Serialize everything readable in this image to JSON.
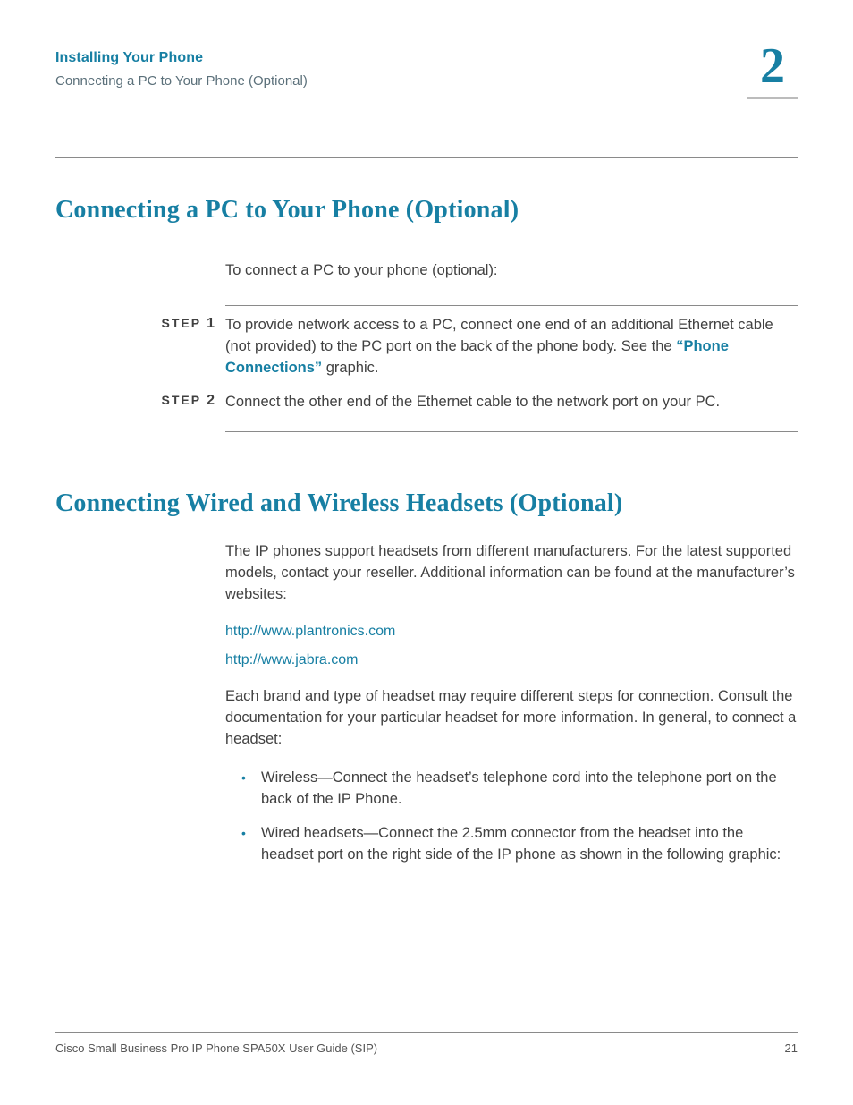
{
  "header": {
    "title": "Installing Your Phone",
    "subtitle": "Connecting a PC to Your Phone (Optional)",
    "chapter_number": "2"
  },
  "section1": {
    "heading": "Connecting a PC to Your Phone (Optional)",
    "intro": "To connect a PC to your phone (optional):",
    "steps": [
      {
        "label": "STEP",
        "num": "1",
        "text_before": "To provide network access to a PC, connect one end of an additional Ethernet cable (not provided) to the PC port on the back of the phone body. See the ",
        "link": "“Phone Connections”",
        "text_after": " graphic."
      },
      {
        "label": "STEP",
        "num": "2",
        "text": "Connect the other end of the Ethernet cable to the network port on your PC."
      }
    ]
  },
  "section2": {
    "heading": "Connecting Wired and Wireless Headsets (Optional)",
    "para1": "The IP phones support headsets from different manufacturers. For the latest supported models, contact your reseller. Additional information can be found at the manufacturer’s websites:",
    "url1": "http://www.plantronics.com",
    "url2": "http://www.jabra.com",
    "para2": "Each brand and type of headset may require different steps for connection. Consult the documentation for your particular headset for more information. In general, to connect a headset:",
    "bullets": [
      "Wireless—Connect the headset’s telephone cord into the telephone port on the back of the IP Phone.",
      "Wired headsets—Connect the 2.5mm connector from the headset into the headset port on the right side of the IP phone as shown in the following graphic:"
    ]
  },
  "footer": {
    "left": "Cisco Small Business Pro IP Phone SPA50X User Guide (SIP)",
    "right": "21"
  }
}
